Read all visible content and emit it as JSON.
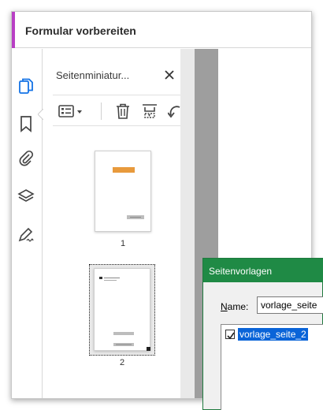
{
  "window": {
    "title": "Formular vorbereiten",
    "accent_color": "#b83fc4"
  },
  "rail": {
    "items": [
      {
        "icon": "page-thumbnails-icon",
        "active": true
      },
      {
        "icon": "bookmark-icon"
      },
      {
        "icon": "attachment-icon"
      },
      {
        "icon": "layers-icon"
      },
      {
        "icon": "signature-icon"
      }
    ]
  },
  "panel": {
    "title": "Seitenminiatur...",
    "toolbar": [
      "options-menu-icon",
      "delete-icon",
      "crop-pages-icon",
      "rotate-icon"
    ],
    "thumbnails": [
      {
        "number": "1",
        "selected": false
      },
      {
        "number": "2",
        "selected": true
      }
    ]
  },
  "dialog": {
    "title": "Seitenvorlagen",
    "name_label_underlined": "N",
    "name_label_rest": "ame:",
    "name_value": "vorlage_seite",
    "templates": [
      {
        "label": "vorlage_seite_2",
        "checked": true
      }
    ],
    "accent_color": "#1f8a45"
  }
}
